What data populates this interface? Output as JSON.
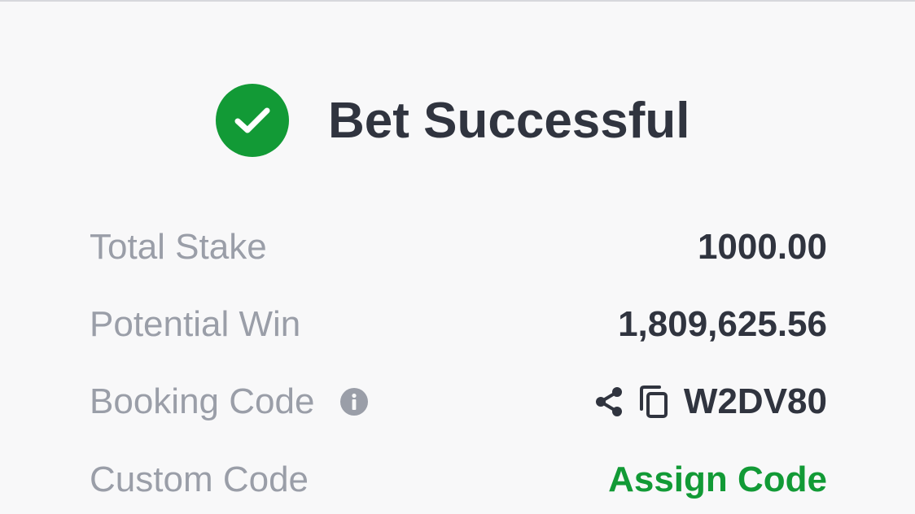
{
  "header": {
    "title": "Bet Successful",
    "icon": "check-circle-icon",
    "accent_color": "#129a36"
  },
  "summary": {
    "total_stake": {
      "label": "Total Stake",
      "value": "1000.00"
    },
    "potential_win": {
      "label": "Potential Win",
      "value": "1,809,625.56"
    },
    "booking_code": {
      "label": "Booking Code",
      "value": "W2DV80",
      "icons": [
        "info-icon",
        "share-icon",
        "copy-icon"
      ]
    },
    "custom_code": {
      "label": "Custom Code",
      "action": "Assign Code"
    }
  }
}
